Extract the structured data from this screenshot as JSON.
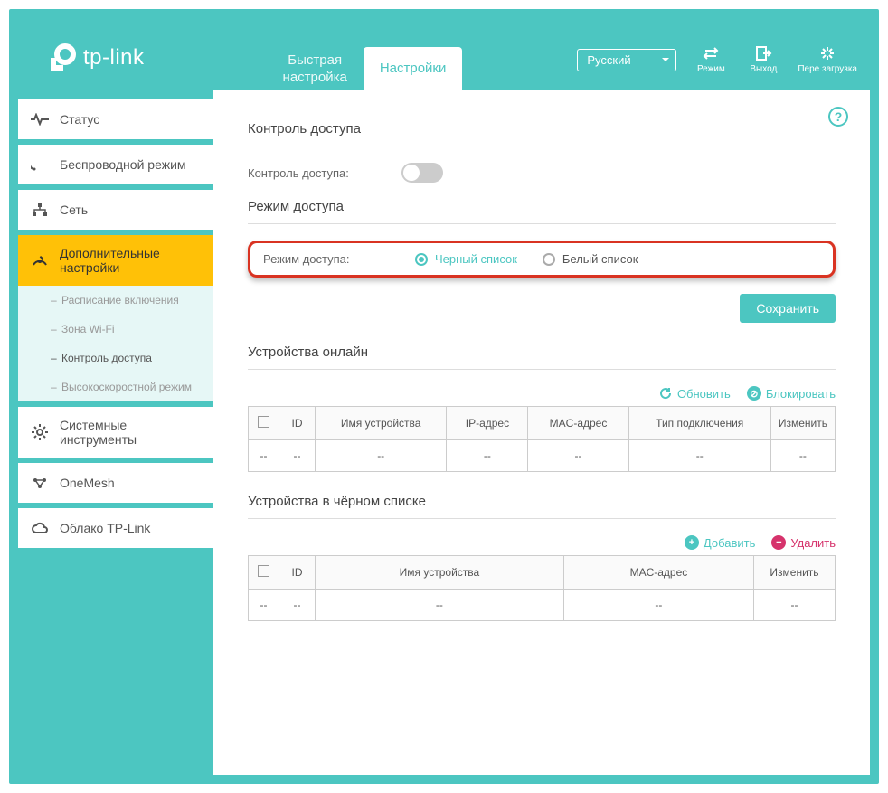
{
  "brand": "tp-link",
  "header": {
    "tabs": {
      "quick": "Быстрая\nнастройка",
      "settings": "Настройки"
    },
    "language": "Русский",
    "buttons": {
      "mode": "Режим",
      "logout": "Выход",
      "reboot": "Пере загрузка"
    }
  },
  "sidebar": {
    "status": "Статус",
    "wireless": "Беспроводной режим",
    "network": "Сеть",
    "advanced": "Дополнительные настройки",
    "advanced_sub": {
      "schedule": "Расписание включения",
      "wifi_zone": "Зона Wi-Fi",
      "access_control": "Контроль доступа",
      "high_speed": "Высокоскоростной режим"
    },
    "system_tools": "Системные инструменты",
    "onemesh": "OneMesh",
    "cloud": "Облако TP-Link"
  },
  "main": {
    "access_control_title": "Контроль доступа",
    "access_control_label": "Контроль доступа:",
    "access_mode_title": "Режим доступа",
    "access_mode_label": "Режим доступа:",
    "blacklist_opt": "Черный список",
    "whitelist_opt": "Белый список",
    "save": "Сохранить",
    "online_title": "Устройства онлайн",
    "blacklist_title": "Устройства в чёрном списке",
    "actions": {
      "refresh": "Обновить",
      "block": "Блокировать",
      "add": "Добавить",
      "delete": "Удалить"
    },
    "online_table": {
      "headers": [
        "ID",
        "Имя устройства",
        "IP-адрес",
        "MAC-адрес",
        "Тип подключения",
        "Изменить"
      ],
      "rows": [
        [
          "--",
          "--",
          "--",
          "--",
          "--",
          "--",
          "--"
        ]
      ]
    },
    "blacklist_table": {
      "headers": [
        "ID",
        "Имя устройства",
        "MAC-адрес",
        "Изменить"
      ],
      "rows": [
        [
          "--",
          "--",
          "--",
          "--",
          "--"
        ]
      ]
    }
  }
}
